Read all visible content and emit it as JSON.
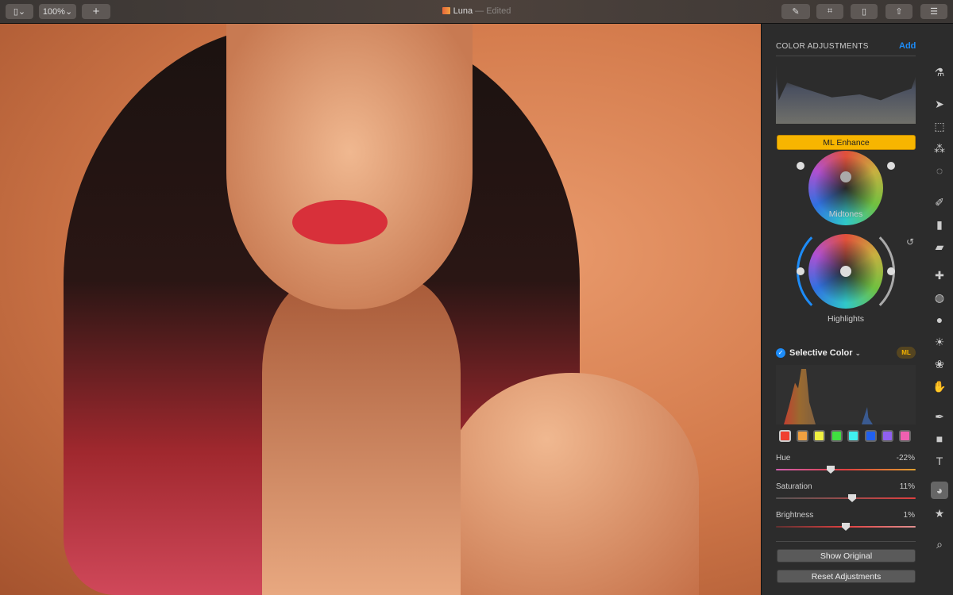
{
  "window": {
    "app_icon": "pixelmator-logo-icon",
    "title": "Luna",
    "status": "— Edited"
  },
  "toolbar": {
    "zoom": "100%",
    "sidebar_toggle": "sidebar-icon",
    "add": "+",
    "right_icons": [
      "paintbrush-icon",
      "crop-icon",
      "document-icon",
      "share-icon",
      "adjustments-icon"
    ]
  },
  "panel": {
    "header": "COLOR ADJUSTMENTS",
    "add": "Add",
    "ml_enhance": "ML Enhance",
    "midtones": "Midtones",
    "highlights": "Highlights",
    "selective_color": {
      "title": "Selective Color",
      "enabled": true,
      "badge": "ML",
      "swatches": [
        "#f04030",
        "#f0a040",
        "#f0f040",
        "#40e040",
        "#40f0f0",
        "#2060f0",
        "#9060f0",
        "#f060b0"
      ],
      "selected_swatch": 0,
      "hue": {
        "label": "Hue",
        "value": "-22%"
      },
      "saturation": {
        "label": "Saturation",
        "value": "11%"
      },
      "brightness": {
        "label": "Brightness",
        "value": "1%"
      }
    },
    "show_original": "Show Original",
    "reset": "Reset Adjustments"
  },
  "tools": [
    "color-picker-icon",
    "arrow-icon",
    "rect-select-icon",
    "magic-select-icon",
    "quick-select-icon",
    "paint-brush-icon",
    "paint-bucket-icon",
    "eraser-icon",
    "repair-icon",
    "clone-icon",
    "blur-icon",
    "light-icon",
    "color-blend-icon",
    "smudge-icon",
    "pen-icon",
    "shape-icon",
    "text-icon",
    "color-adjust-icon",
    "effects-icon",
    "zoom-icon"
  ],
  "accent": "#1d8cf8",
  "ml_color": "#f7b500"
}
